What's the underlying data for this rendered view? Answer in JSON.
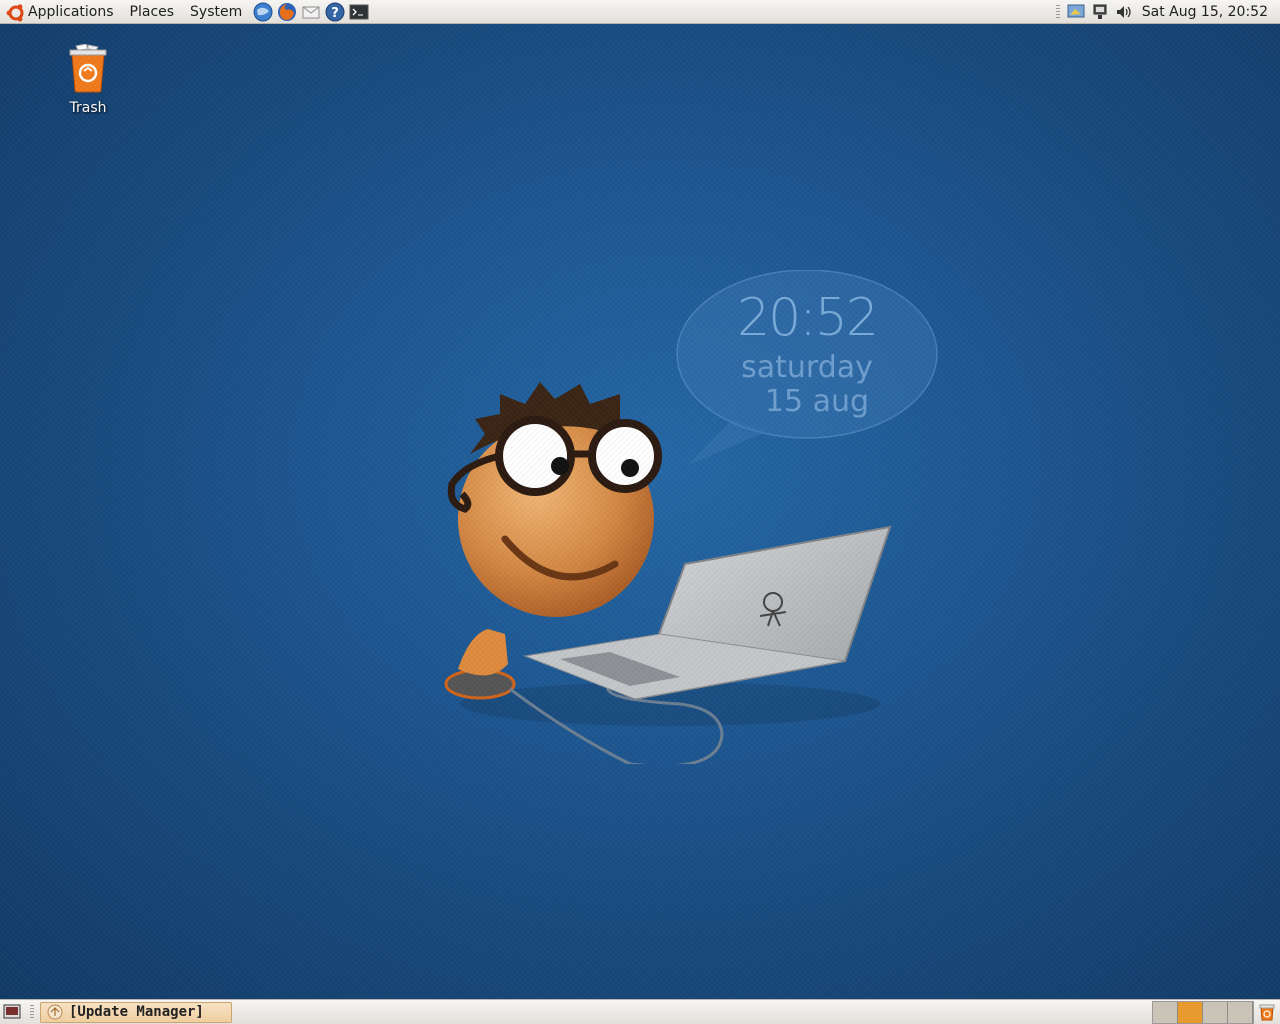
{
  "top_panel": {
    "menus": [
      "Applications",
      "Places",
      "System"
    ],
    "launchers": [
      "web-browser-icon",
      "firefox-icon",
      "mail-icon",
      "help-icon",
      "terminal-icon"
    ],
    "clock": "Sat Aug 15, 20:52",
    "tray": [
      "display-icon",
      "network-icon",
      "volume-icon"
    ]
  },
  "desktop": {
    "trash_label": "Trash",
    "clock_widget": {
      "time": "20:52",
      "day": "saturday",
      "date": "15 aug"
    }
  },
  "bottom_panel": {
    "task_label": "[Update Manager]",
    "workspaces": 4,
    "active_workspace": 2
  },
  "colors": {
    "accent": "#e89a2e",
    "desktop_blue": "#1d5792",
    "panel_bg": "#ece9e5"
  }
}
